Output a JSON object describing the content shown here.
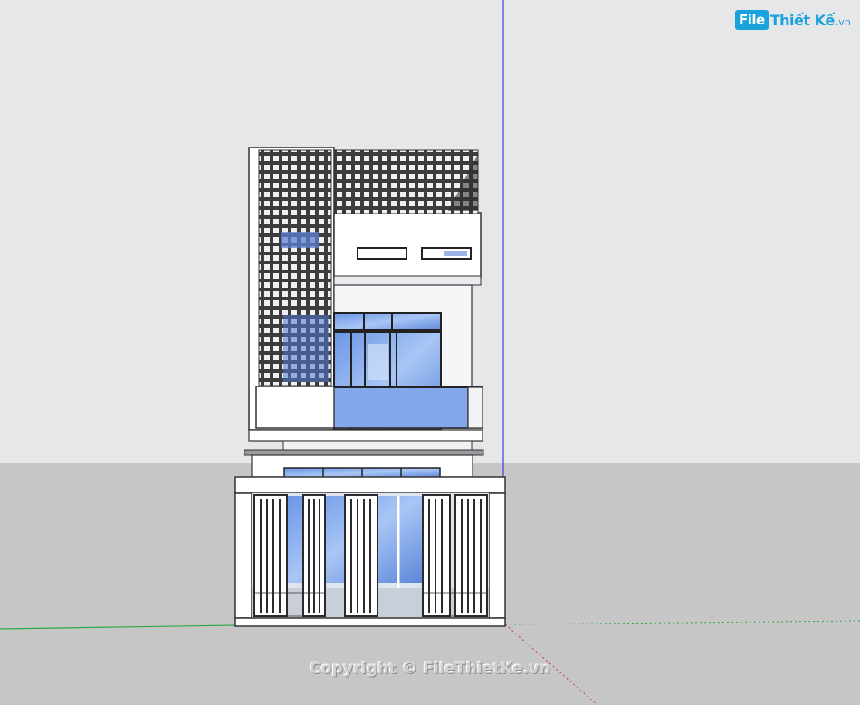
{
  "watermark": {
    "logo_box": "File",
    "logo_name": "Thiết Kế",
    "logo_domain": ".vn",
    "copyright": "Copyright © FileThietKe.vn"
  },
  "scene": {
    "sky_color": "#e6e7e9",
    "ground_color": "#c6c6c7",
    "axis_blue": "#3b3ee0",
    "axis_green": "#2ea84a",
    "axis_red": "#d23b3b",
    "glass_color": "#7fa9ef",
    "lattice_color": "#4a4a4a"
  }
}
